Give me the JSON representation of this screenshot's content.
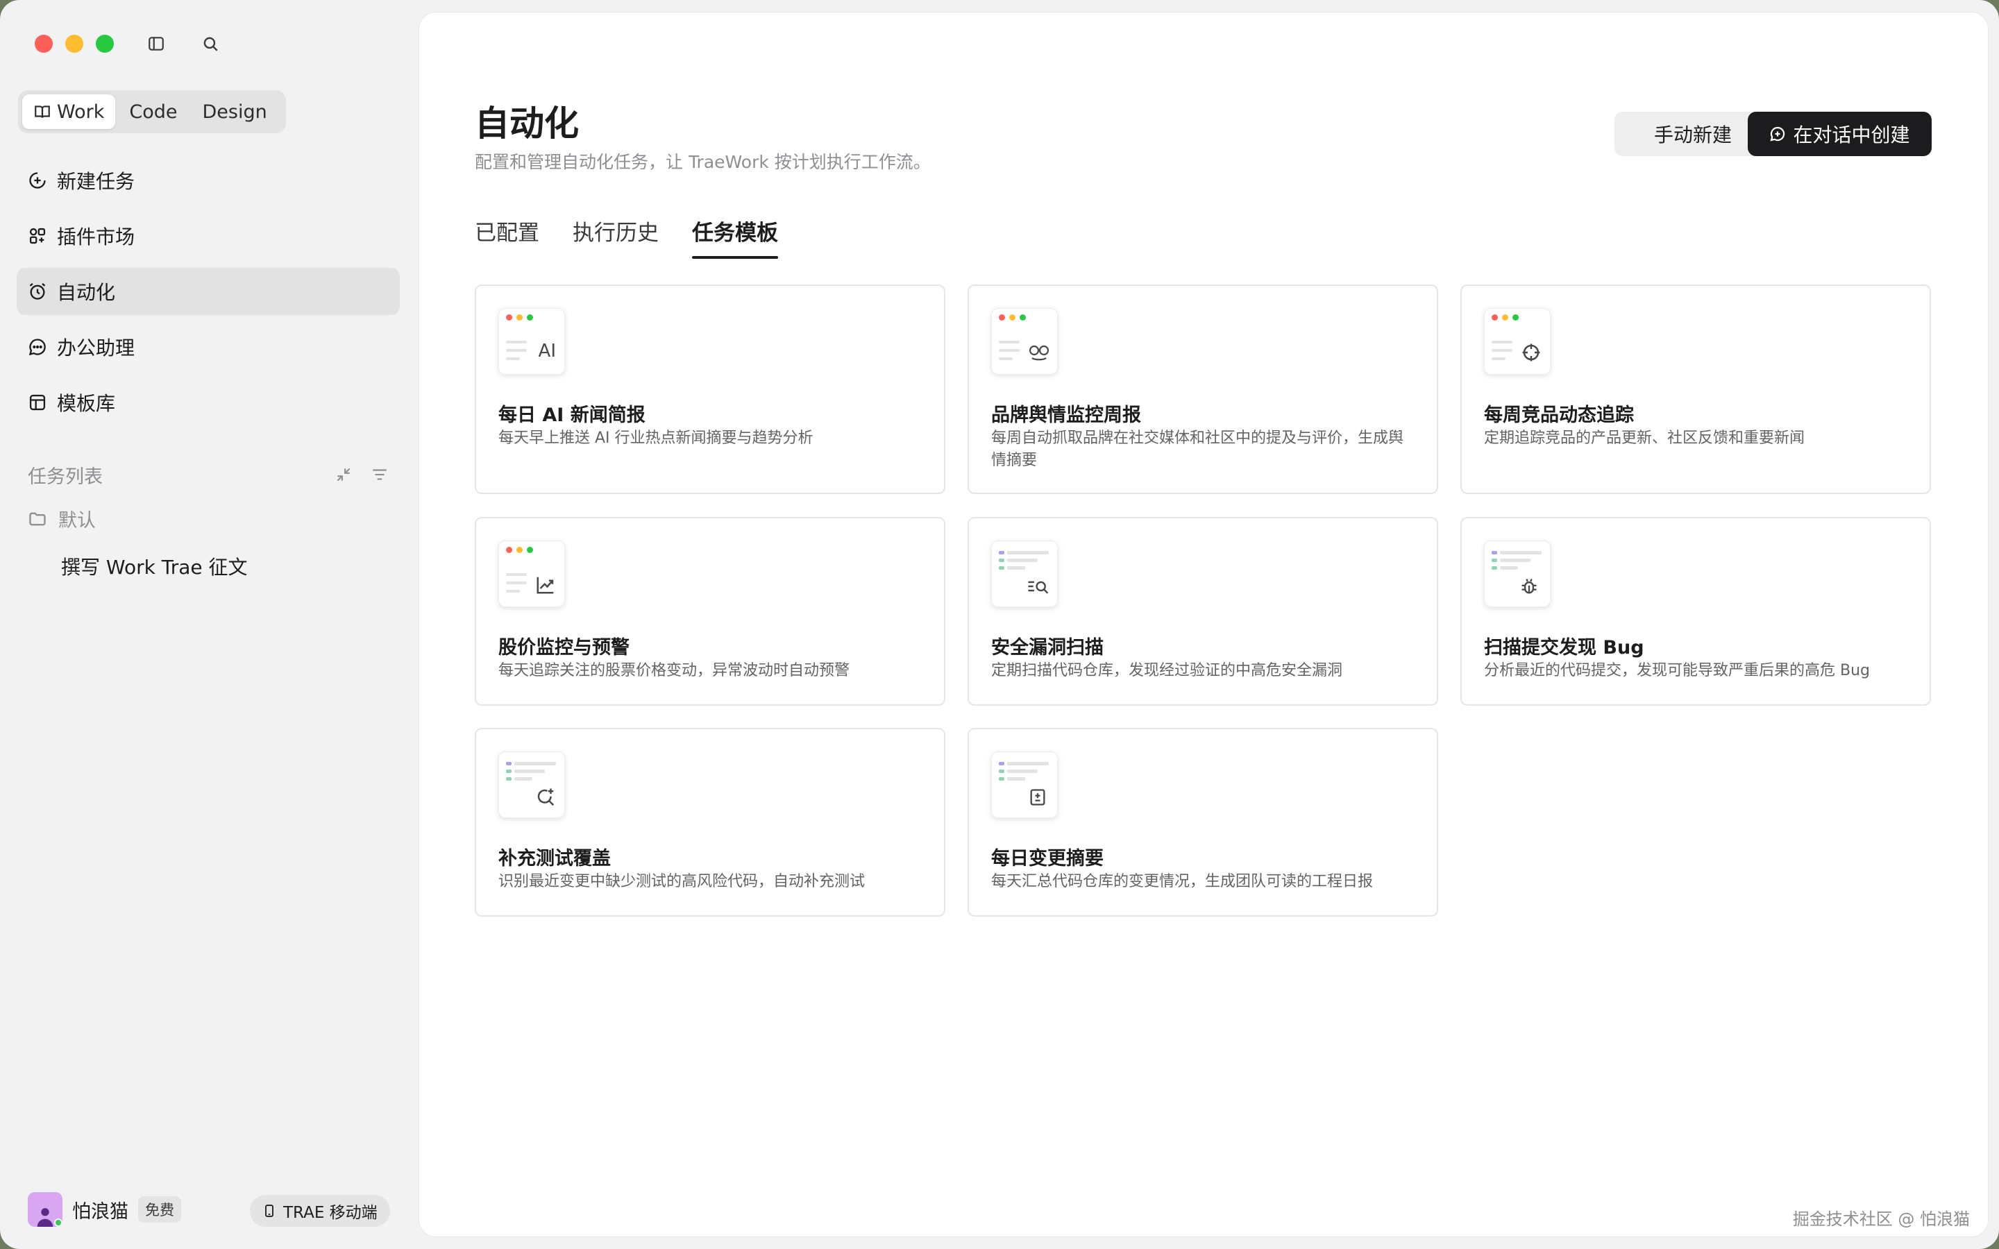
{
  "sidebar": {
    "modes": [
      "Work",
      "Code",
      "Design"
    ],
    "nav": [
      {
        "label": "新建任务",
        "icon": "plus-circle-icon"
      },
      {
        "label": "插件市场",
        "icon": "plugins-icon"
      },
      {
        "label": "自动化",
        "icon": "alarm-clock-icon"
      },
      {
        "label": "办公助理",
        "icon": "chat-bubble-icon"
      },
      {
        "label": "模板库",
        "icon": "template-icon"
      }
    ],
    "tasks_title": "任务列表",
    "folder": "默认",
    "task_entry": "撰写 Work Trae 征文",
    "user": {
      "name": "怕浪猫",
      "badge": "免费"
    },
    "mobile_button": "TRAE 移动端"
  },
  "main": {
    "title": "自动化",
    "subtitle": "配置和管理自动化任务，让 TraeWork 按计划执行工作流。",
    "manual_button": "手动新建",
    "chat_create_button": "在对话中创建",
    "tabs": [
      "已配置",
      "执行历史",
      "任务模板"
    ],
    "active_tab": "任务模板",
    "cards": [
      {
        "title": "每日 AI 新闻简报",
        "desc": "每天早上推送 AI 行业热点新闻摘要与趋势分析",
        "glyph": "AI",
        "style": "window"
      },
      {
        "title": "品牌舆情监控周报",
        "desc": "每周自动抓取品牌在社交媒体和社区中的提及与评价，生成舆情摘要",
        "glyph": "∞",
        "style": "window"
      },
      {
        "title": "每周竞品动态追踪",
        "desc": "定期追踪竞品的产品更新、社区反馈和重要新闻",
        "glyph": "⌖",
        "style": "window"
      },
      {
        "title": "股价监控与预警",
        "desc": "每天追踪关注的股票价格变动，异常波动时自动预警",
        "glyph": "📈",
        "style": "window"
      },
      {
        "title": "安全漏洞扫描",
        "desc": "定期扫描代码仓库，发现经过验证的中高危安全漏洞",
        "glyph": "🔍",
        "style": "code"
      },
      {
        "title": "扫描提交发现 Bug",
        "desc": "分析最近的代码提交，发现可能导致严重后果的高危 Bug",
        "glyph": "🐞",
        "style": "code"
      },
      {
        "title": "补充测试覆盖",
        "desc": "识别最近变更中缺少测试的高风险代码，自动补充测试",
        "glyph": "↻",
        "style": "code"
      },
      {
        "title": "每日变更摘要",
        "desc": "每天汇总代码仓库的变更情况，生成团队可读的工程日报",
        "glyph": "±",
        "style": "code"
      }
    ]
  },
  "watermark": "掘金技术社区 @ 怕浪猫",
  "colors": {
    "accent_dark": "#1c1c1e",
    "active_nav_bg": "#e2e2e2",
    "sidebar_bg": "#f2f2f2"
  }
}
